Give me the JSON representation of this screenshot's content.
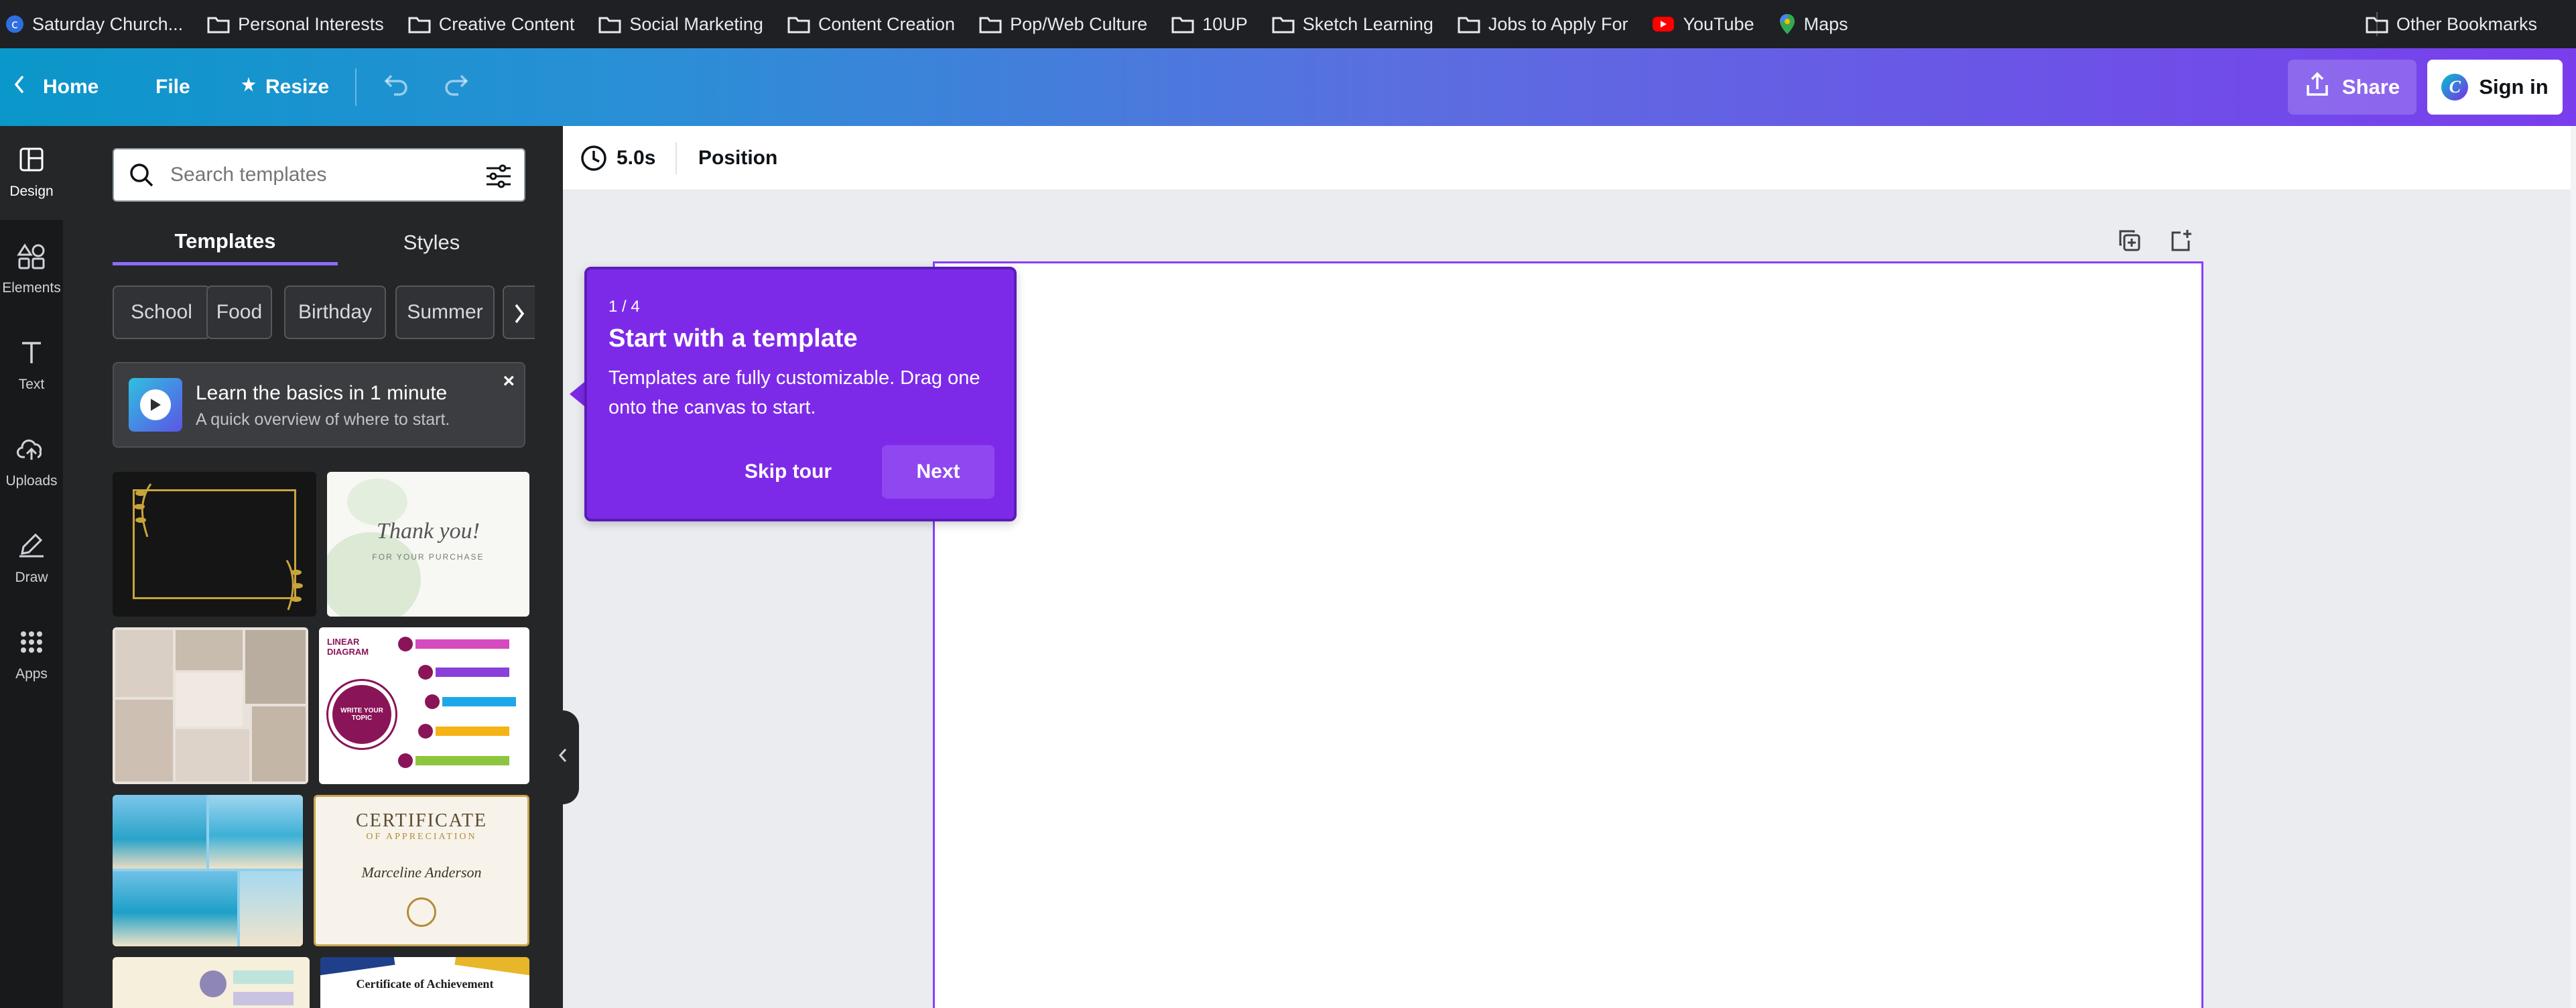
{
  "bookmarks": {
    "items": [
      {
        "label": "Saturday Church...",
        "icon": "canva-favicon"
      },
      {
        "label": "Personal Interests",
        "icon": "folder-icon"
      },
      {
        "label": "Creative Content",
        "icon": "folder-icon"
      },
      {
        "label": "Social Marketing",
        "icon": "folder-icon"
      },
      {
        "label": "Content Creation",
        "icon": "folder-icon"
      },
      {
        "label": "Pop/Web Culture",
        "icon": "folder-icon"
      },
      {
        "label": "10UP",
        "icon": "folder-icon"
      },
      {
        "label": "Sketch Learning",
        "icon": "folder-icon"
      },
      {
        "label": "Jobs to Apply For",
        "icon": "folder-icon"
      },
      {
        "label": "YouTube",
        "icon": "youtube-icon"
      },
      {
        "label": "Maps",
        "icon": "maps-icon"
      }
    ],
    "other": "Other Bookmarks"
  },
  "toolbar": {
    "home": "Home",
    "file": "File",
    "resize": "Resize",
    "share": "Share",
    "sign_in": "Sign in"
  },
  "rail": {
    "items": [
      {
        "label": "Design",
        "icon": "layout-icon"
      },
      {
        "label": "Elements",
        "icon": "shapes-icon"
      },
      {
        "label": "Text",
        "icon": "text-icon"
      },
      {
        "label": "Uploads",
        "icon": "cloud-upload-icon"
      },
      {
        "label": "Draw",
        "icon": "pen-icon"
      },
      {
        "label": "Apps",
        "icon": "apps-grid-icon"
      }
    ]
  },
  "panel": {
    "search_placeholder": "Search templates",
    "tabs": [
      "Templates",
      "Styles"
    ],
    "chips": [
      "School",
      "Food",
      "Birthday",
      "Summer"
    ],
    "learn_title": "Learn the basics in 1 minute",
    "learn_subtitle": "A quick overview of where to start.",
    "thumbs": {
      "thank_you": "Thank you!",
      "thank_sub": "FOR YOUR PURCHASE",
      "linear_title": "LINEAR DIAGRAM",
      "write_topic": "WRITE YOUR TOPIC",
      "cert_title": "CERTIFICATE",
      "cert_sub": "OF APPRECIATION",
      "cert_name": "Marceline Anderson",
      "cert2_title": "Certificate of Achievement"
    }
  },
  "editor": {
    "duration": "5.0s",
    "position": "Position"
  },
  "tour": {
    "step": "1 / 4",
    "title": "Start with a template",
    "body": "Templates are fully customizable. Drag one onto the canvas to start.",
    "skip": "Skip tour",
    "next": "Next"
  },
  "colors": {
    "accent": "#7d2ae8",
    "canvas_border": "#8b3dff",
    "rail_bg": "#18191b",
    "panel_bg": "#252627"
  }
}
